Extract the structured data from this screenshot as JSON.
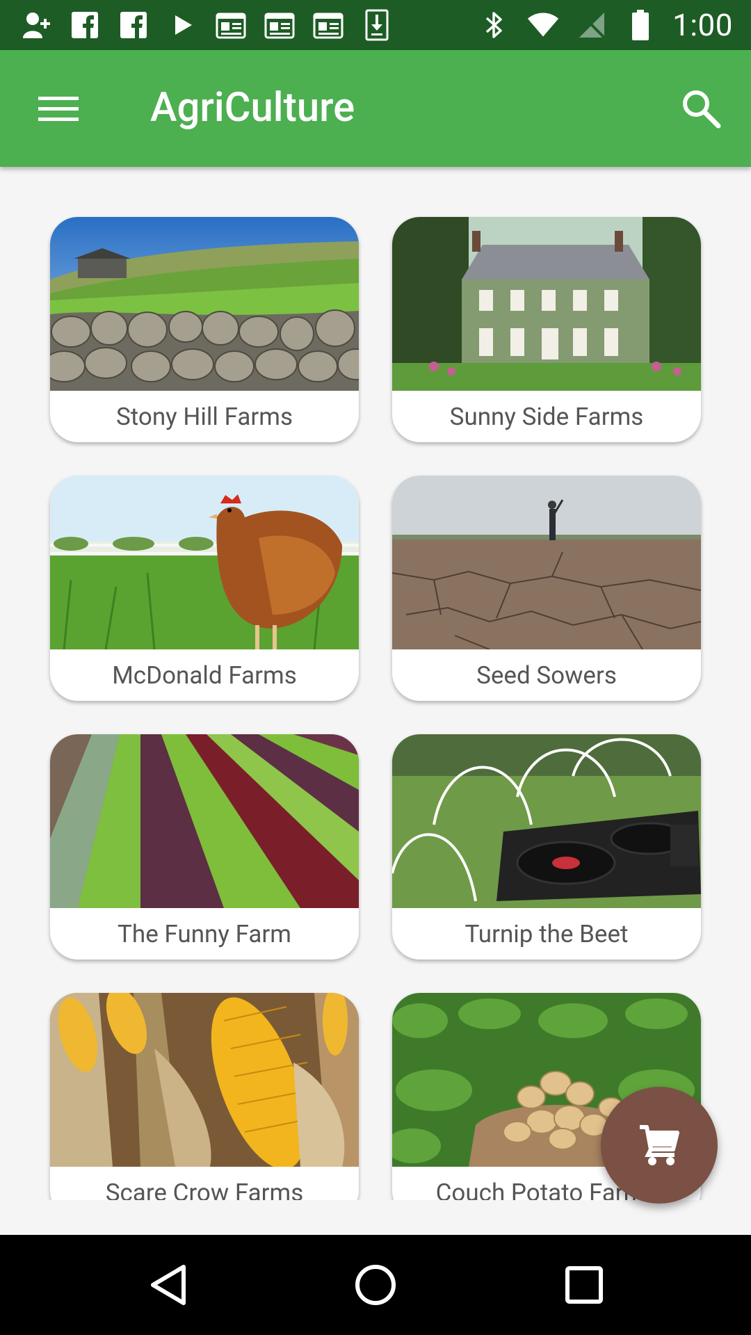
{
  "status_bar": {
    "time": "1:00",
    "left_icons": [
      "add-contact-icon",
      "facebook-icon",
      "facebook-icon",
      "play-icon",
      "news-icon",
      "news-icon",
      "news-icon",
      "download-icon"
    ],
    "right_icons": [
      "bluetooth-icon",
      "wifi-icon",
      "no-signal-icon",
      "battery-icon"
    ]
  },
  "app_bar": {
    "title": "AgriCulture",
    "color": "#4caf50"
  },
  "farms": [
    {
      "name": "Stony Hill Farms",
      "image": "stone-wall-field-image"
    },
    {
      "name": "Sunny Side Farms",
      "image": "manor-house-image"
    },
    {
      "name": "McDonald Farms",
      "image": "chicken-image"
    },
    {
      "name": "Seed Sowers",
      "image": "dry-field-image"
    },
    {
      "name": "The Funny Farm",
      "image": "lettuce-rows-image"
    },
    {
      "name": "Turnip the Beet",
      "image": "turntable-field-image"
    },
    {
      "name": "Scare Crow Farms",
      "image": "corn-image"
    },
    {
      "name": "Couch Potato Farms",
      "image": "potatoes-image"
    }
  ],
  "fab": {
    "icon": "cart-icon",
    "color": "#7b5045"
  }
}
